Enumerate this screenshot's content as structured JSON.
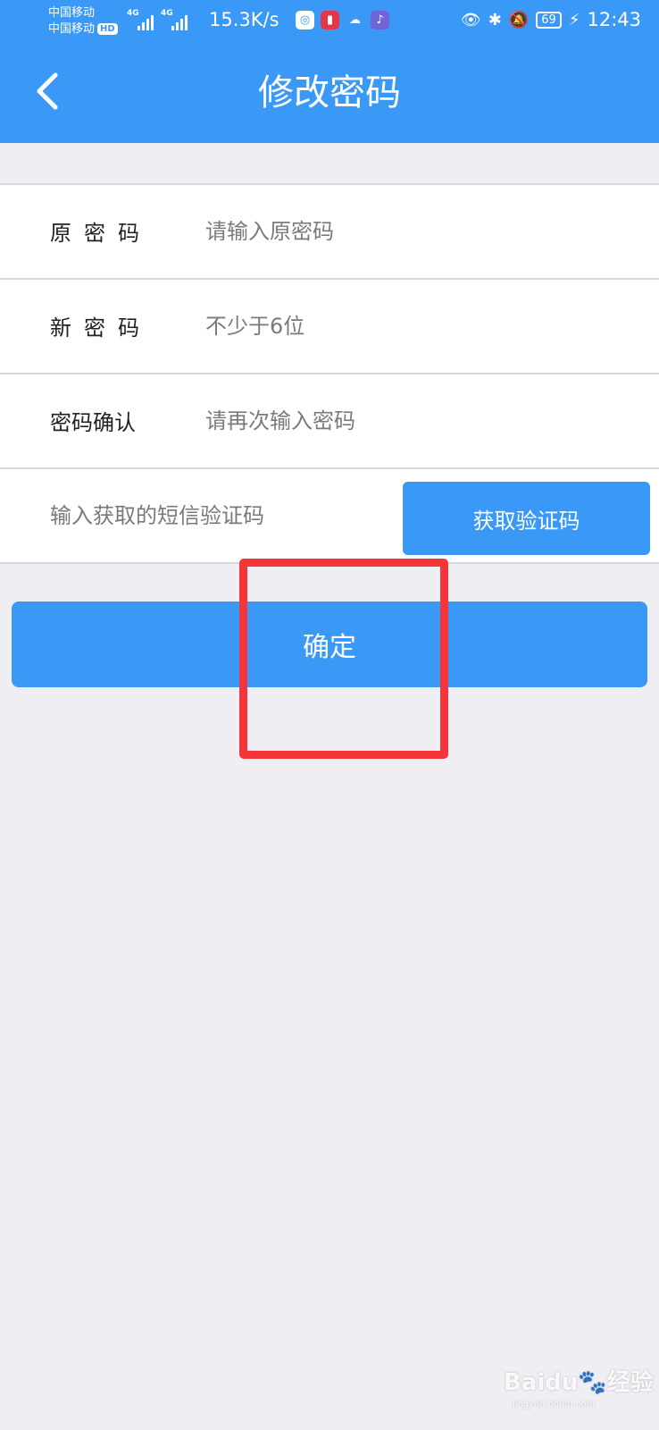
{
  "status_bar": {
    "carrier1": "中国移动",
    "carrier2": "中国移动",
    "hd_badge": "HD",
    "sim1_network": "4G",
    "sim2_network": "4G",
    "net_speed": "15.3K/s",
    "battery": "69",
    "time": "12:43",
    "icons": [
      "eye-icon",
      "bluetooth-icon",
      "bell-off-icon",
      "charging-icon"
    ]
  },
  "nav": {
    "title": "修改密码",
    "back_icon": "chevron-left-icon"
  },
  "form": {
    "old_password": {
      "label": "原密码",
      "placeholder": "请输入原密码"
    },
    "new_password": {
      "label": "新密码",
      "placeholder": "不少于6位"
    },
    "confirm_password": {
      "label": "密码确认",
      "placeholder": "请再次输入密码"
    },
    "sms_code": {
      "placeholder": "输入获取的短信验证码",
      "button_label": "获取验证码"
    }
  },
  "submit": {
    "label": "确定"
  },
  "colors": {
    "primary": "#3a98f6",
    "background": "#eeeef3",
    "highlight": "#f4363a"
  },
  "watermark": {
    "brand": "Baidu",
    "product": "经验",
    "url": "jingyan.baidu.com"
  }
}
